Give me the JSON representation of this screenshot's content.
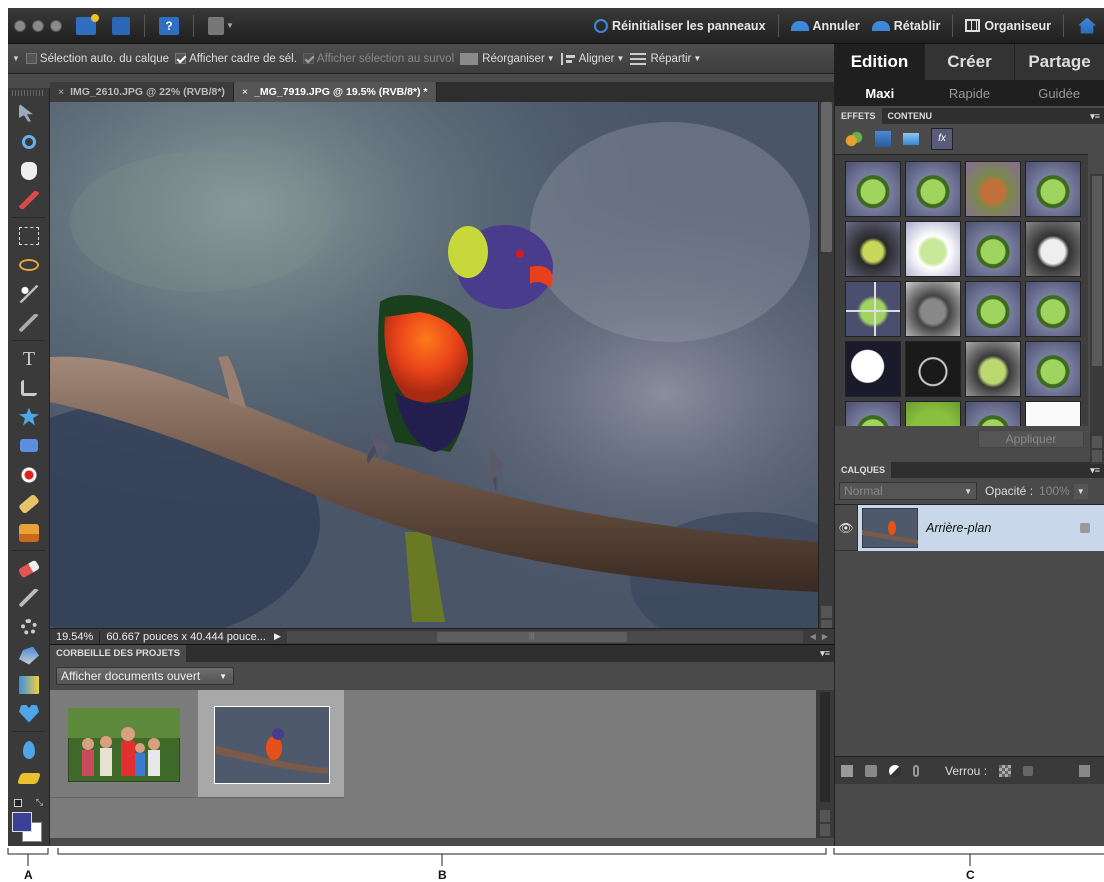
{
  "menubar": {
    "reset_panels": "Réinitialiser les panneaux",
    "undo": "Annuler",
    "redo": "Rétablir",
    "organizer": "Organiseur"
  },
  "options": {
    "auto_select": "Sélection auto. du calque",
    "show_bbox": "Afficher cadre de sél.",
    "show_hover": "Afficher sélection au survol",
    "arrange": "Réorganiser",
    "align": "Aligner",
    "distribute": "Répartir"
  },
  "doc_tabs": [
    {
      "close": "×",
      "label": "IMG_2610.JPG @ 22% (RVB/8*)"
    },
    {
      "close": "×",
      "label": "_MG_7919.JPG @ 19.5% (RVB/8*) *"
    }
  ],
  "status": {
    "zoom": "19.54%",
    "dimensions": "60.667 pouces x 40.444 pouce..."
  },
  "project_bin": {
    "title": "CORBEILLE DES PROJETS",
    "dropdown": "Afficher documents ouvert",
    "scroll_grip": "|||"
  },
  "right_panel": {
    "modes": [
      "Edition",
      "Créer",
      "Partage"
    ],
    "submodes": [
      "Maxi",
      "Rapide",
      "Guidée"
    ],
    "effects_tabs": [
      "EFFETS",
      "CONTENU"
    ],
    "apply": "Appliquer",
    "layers_title": "CALQUES",
    "blend_mode": "Normal",
    "opacity_label": "Opacité :",
    "opacity_value": "100%",
    "layer_name": "Arrière-plan",
    "lock_label": "Verrou :"
  },
  "callouts": [
    "A",
    "B",
    "C"
  ],
  "colors": {
    "foreground": "#3b3f98",
    "background": "#ffffff",
    "accent_blue": "#3d88d8"
  }
}
